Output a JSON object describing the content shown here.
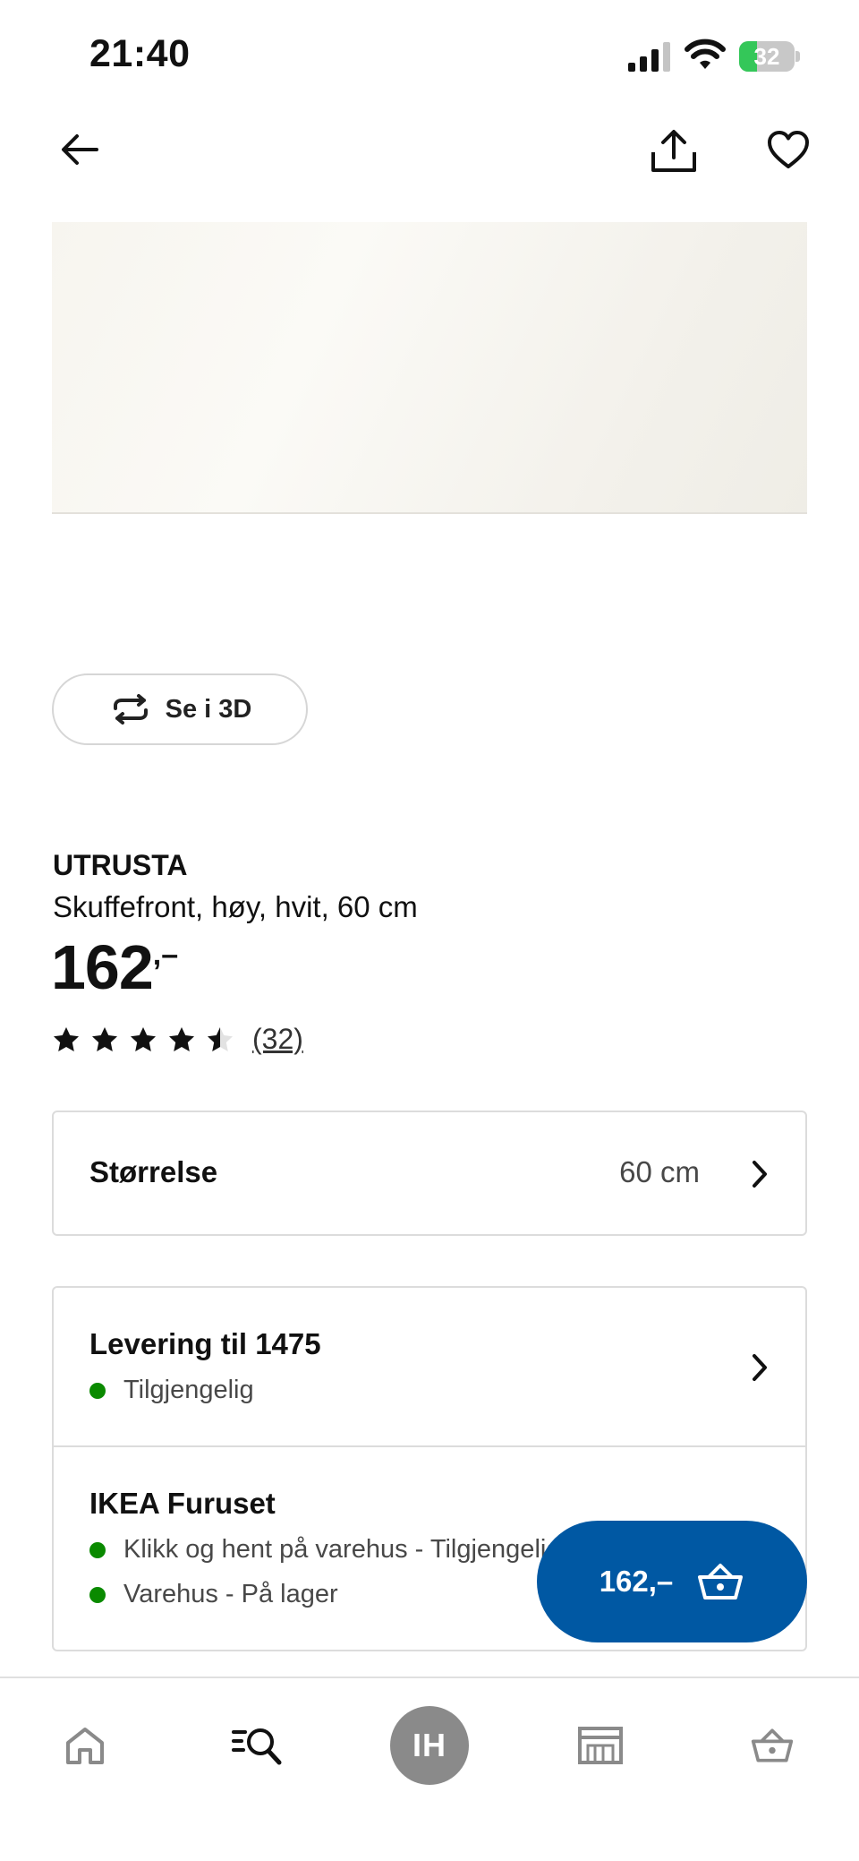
{
  "status_bar": {
    "time": "21:40",
    "battery_level": "32",
    "icons": [
      "signal-icon",
      "wifi-icon",
      "battery-charging-icon"
    ]
  },
  "header": {
    "icons": [
      "back-arrow-icon",
      "share-icon",
      "heart-icon"
    ]
  },
  "view_3d": {
    "label": "Se i 3D",
    "icon": "rotate-3d-icon"
  },
  "product": {
    "name": "UTRUSTA",
    "description": "Skuffefront, høy, hvit, 60 cm",
    "price_integer": "162",
    "price_suffix": ",–",
    "rating_value": 4.5,
    "rating_max": 5,
    "rating_count": "(32)"
  },
  "size": {
    "label": "Størrelse",
    "value": "60 cm"
  },
  "delivery": {
    "title": "Levering til 1475",
    "status": "Tilgjengelig"
  },
  "store": {
    "title": "IKEA Furuset",
    "lines": [
      "Klikk og hent på varehus - Tilgjengelig",
      "Varehus - På lager"
    ]
  },
  "cart_button": {
    "price": "162,–",
    "icon": "basket-icon"
  },
  "bottom_nav": {
    "items": [
      "home-icon",
      "search-icon",
      "profile-avatar",
      "store-icon",
      "basket-icon"
    ],
    "avatar_initials": "IH"
  },
  "colors": {
    "accent": "#0058a3",
    "available_dot": "#0a8a00",
    "avatar_bg": "#8a8a8a",
    "battery_fill": "#34c759"
  }
}
